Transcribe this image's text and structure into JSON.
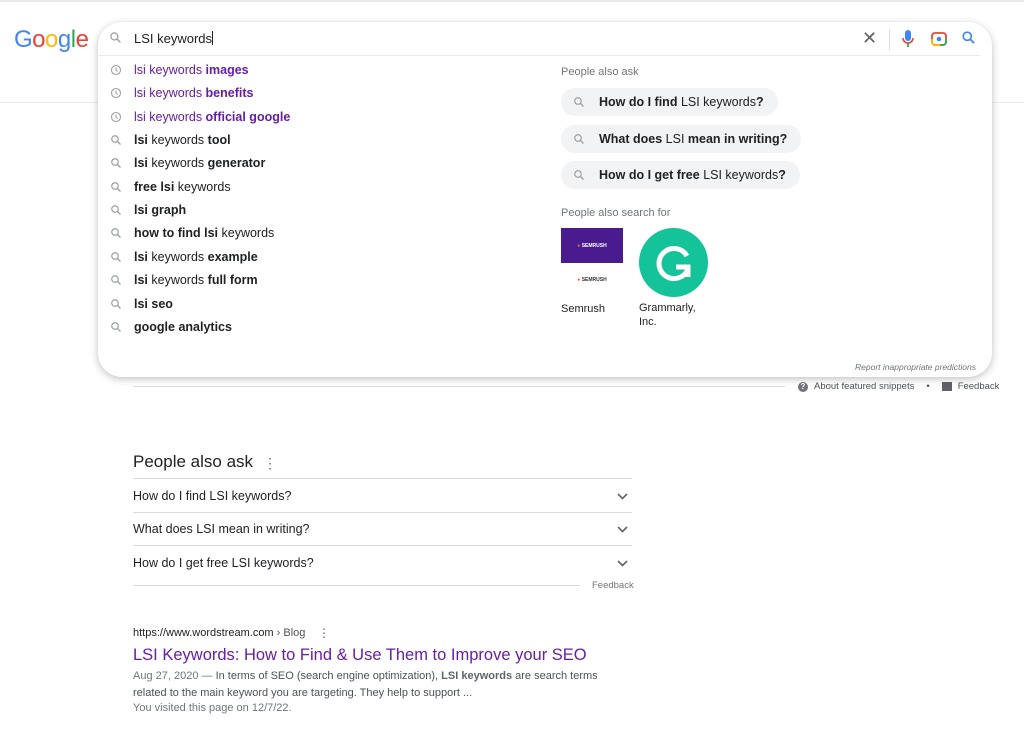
{
  "logo": "Google",
  "search": {
    "query": "LSI keywords"
  },
  "suggestions": [
    {
      "type": "history",
      "parts": [
        {
          "t": "lsi keywords ",
          "b": false
        },
        {
          "t": "images",
          "b": true
        }
      ]
    },
    {
      "type": "history",
      "parts": [
        {
          "t": "lsi keywords ",
          "b": false
        },
        {
          "t": "benefits",
          "b": true
        }
      ]
    },
    {
      "type": "history",
      "parts": [
        {
          "t": "lsi keywords ",
          "b": false
        },
        {
          "t": "official google",
          "b": true
        }
      ]
    },
    {
      "type": "search",
      "parts": [
        {
          "t": "lsi",
          "b": true
        },
        {
          "t": " keywords ",
          "b": false
        },
        {
          "t": "tool",
          "b": true
        }
      ]
    },
    {
      "type": "search",
      "parts": [
        {
          "t": "lsi",
          "b": true
        },
        {
          "t": " keywords ",
          "b": false
        },
        {
          "t": "generator",
          "b": true
        }
      ]
    },
    {
      "type": "search",
      "parts": [
        {
          "t": "free lsi",
          "b": true
        },
        {
          "t": " keywords",
          "b": false
        }
      ]
    },
    {
      "type": "search",
      "parts": [
        {
          "t": "lsi graph",
          "b": true
        }
      ]
    },
    {
      "type": "search",
      "parts": [
        {
          "t": "how to find lsi",
          "b": true
        },
        {
          "t": " keywords",
          "b": false
        }
      ]
    },
    {
      "type": "search",
      "parts": [
        {
          "t": "lsi",
          "b": true
        },
        {
          "t": " keywords ",
          "b": false
        },
        {
          "t": "example",
          "b": true
        }
      ]
    },
    {
      "type": "search",
      "parts": [
        {
          "t": "lsi",
          "b": true
        },
        {
          "t": " keywords ",
          "b": false
        },
        {
          "t": "full form",
          "b": true
        }
      ]
    },
    {
      "type": "search",
      "parts": [
        {
          "t": "lsi seo",
          "b": true
        }
      ]
    },
    {
      "type": "search",
      "parts": [
        {
          "t": "google analytics",
          "b": true
        }
      ]
    }
  ],
  "people_also_ask_label": "People also ask",
  "ask_chips": [
    [
      {
        "t": "How do I find ",
        "b": true
      },
      {
        "t": "LSI keywords",
        "b": false
      },
      {
        "t": "?",
        "b": true
      }
    ],
    [
      {
        "t": "What does ",
        "b": true
      },
      {
        "t": "LSI",
        "b": false
      },
      {
        "t": " mean in writing?",
        "b": true
      }
    ],
    [
      {
        "t": "How do I get free ",
        "b": true
      },
      {
        "t": "LSI keywords",
        "b": false
      },
      {
        "t": "?",
        "b": true
      }
    ]
  ],
  "people_also_search_label": "People also search for",
  "entities": [
    {
      "name": "Semrush",
      "logo_text": "SEMRUSH"
    },
    {
      "name": "Grammarly, Inc."
    }
  ],
  "report_link": "Report inappropriate predictions",
  "about_snippets": "About featured snippets",
  "feedback": "Feedback",
  "paa": {
    "title": "People also ask",
    "questions": [
      "How do I find LSI keywords?",
      "What does LSI mean in writing?",
      "How do I get free LSI keywords?"
    ],
    "feedback": "Feedback"
  },
  "result": {
    "url": "https://www.wordstream.com",
    "crumb": " › Blog",
    "title": "LSI Keywords: How to Find & Use Them to Improve your SEO",
    "date": "Aug 27, 2020 — ",
    "snippet_a": "In terms of SEO (search engine optimization), ",
    "snippet_bold": "LSI keywords",
    "snippet_b": " are search terms related to the main keyword you are targeting. They help to support ...",
    "visited": "You visited this page on 12/7/22."
  },
  "colors": {
    "visited": "#681da8",
    "grammarly": "#15c39a",
    "semrush": "#4a1b8f"
  }
}
